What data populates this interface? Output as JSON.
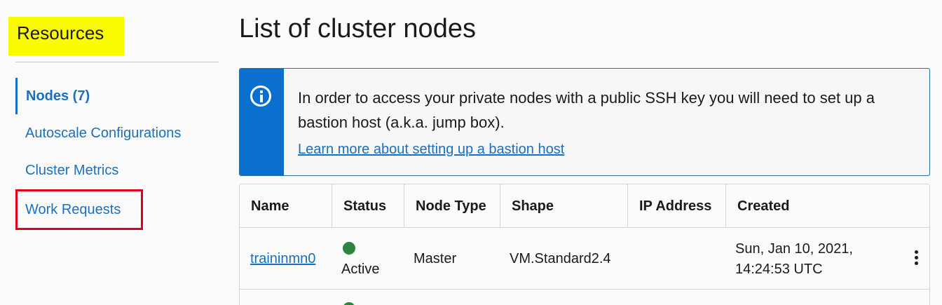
{
  "sidebar": {
    "title": "Resources",
    "items": [
      {
        "label": "Nodes (7)"
      },
      {
        "label": "Autoscale Configurations"
      },
      {
        "label": "Cluster Metrics"
      },
      {
        "label": "Work Requests"
      }
    ]
  },
  "main": {
    "title": "List of cluster nodes",
    "info": {
      "text": "In order to access your private nodes with a public SSH key you will need to set up a bastion host (a.k.a. jump box).",
      "link": "Learn more about setting up a bastion host",
      "icon": "info-icon"
    },
    "table": {
      "columns": [
        "Name",
        "Status",
        "Node Type",
        "Shape",
        "IP Address",
        "Created"
      ],
      "rows": [
        {
          "name": "traininmn0",
          "status": "Active",
          "status_color": "#2e8540",
          "node_type": "Master",
          "shape": "VM.Standard2.4",
          "ip": "",
          "created_line1": "Sun, Jan 10, 2021,",
          "created_line2": "14:24:53 UTC"
        }
      ]
    }
  },
  "colors": {
    "accent": "#1a6fbf",
    "info_strip": "#0b6fcf",
    "highlight_yellow": "#fbfb00",
    "highlight_red": "#e0001b"
  }
}
